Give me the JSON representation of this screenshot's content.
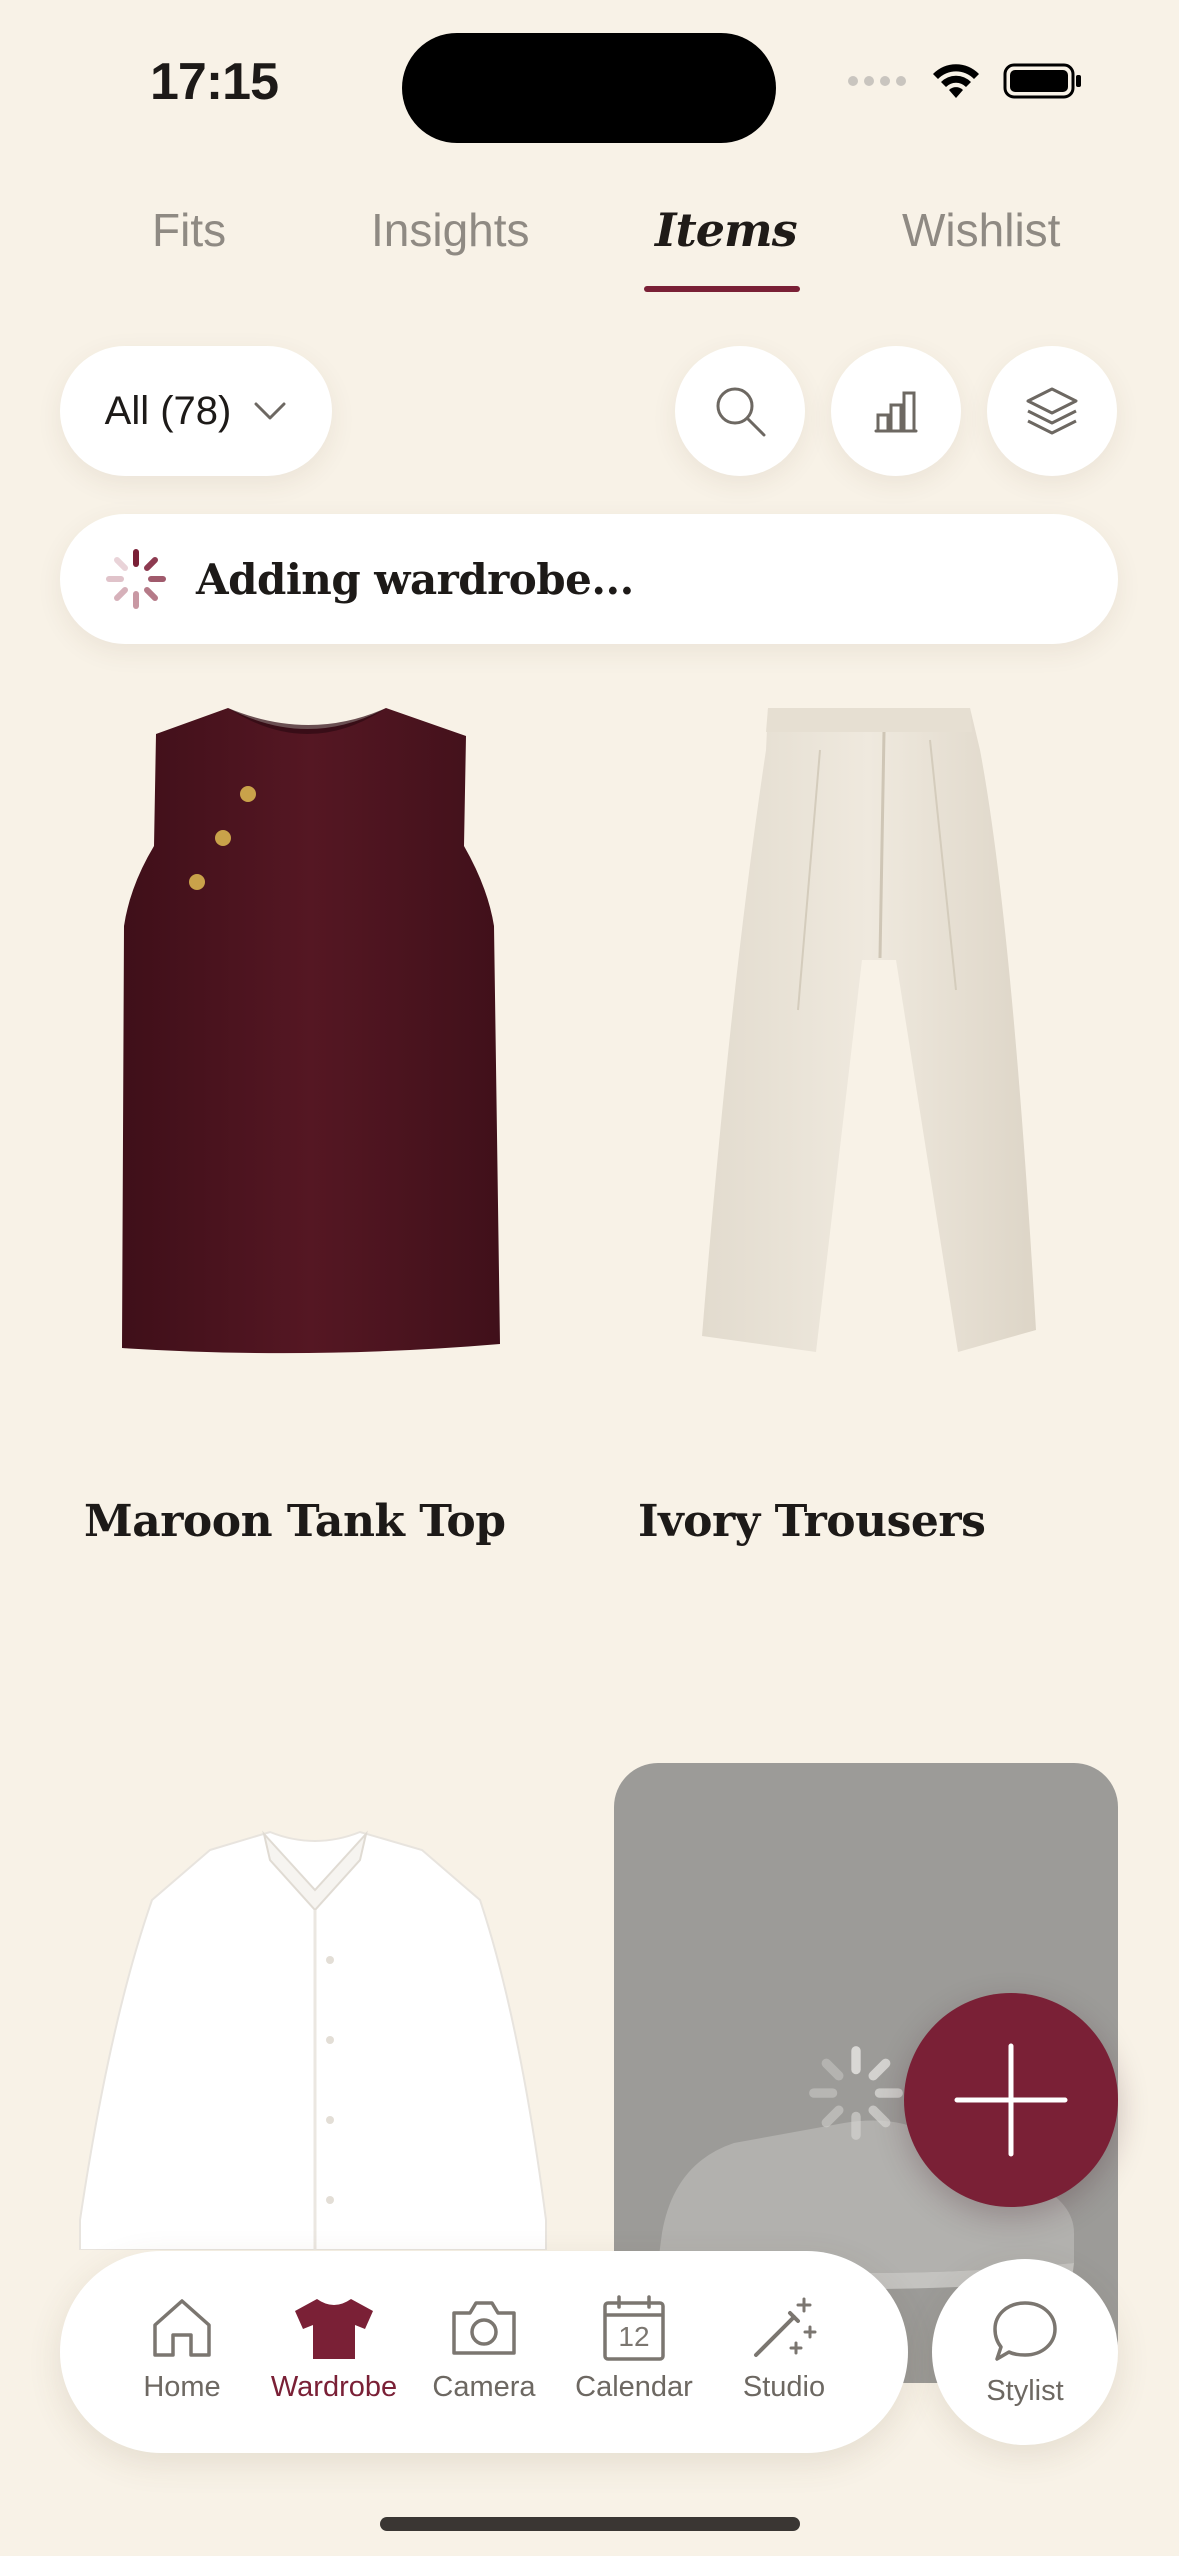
{
  "status": {
    "time": "17:15"
  },
  "tabs": [
    {
      "label": "Fits"
    },
    {
      "label": "Insights"
    },
    {
      "label": "Items",
      "active": true
    },
    {
      "label": "Wishlist"
    }
  ],
  "filter": {
    "label": "All (78)"
  },
  "toolbar_icons": [
    "search-icon",
    "stats-icon",
    "layers-icon"
  ],
  "banner": {
    "text": "Adding wardrobe..."
  },
  "items": [
    {
      "name": "Maroon Tank Top",
      "color": "#4e1420"
    },
    {
      "name": "Ivory Trousers",
      "color": "#ebe4d7"
    },
    {
      "name": "",
      "color": "#ffffff"
    },
    {
      "name": "",
      "state": "loading"
    }
  ],
  "fab": {
    "icon": "plus-icon"
  },
  "nav": [
    {
      "label": "Home",
      "icon": "home-icon"
    },
    {
      "label": "Wardrobe",
      "icon": "tshirt-icon",
      "active": true
    },
    {
      "label": "Camera",
      "icon": "camera-icon"
    },
    {
      "label": "Calendar",
      "icon": "calendar-icon",
      "badge": "12"
    },
    {
      "label": "Studio",
      "icon": "magic-wand-icon"
    }
  ],
  "stylist": {
    "label": "Stylist",
    "icon": "chat-bubble-icon"
  },
  "colors": {
    "accent": "#7a2036",
    "background": "#F8F2E7"
  }
}
